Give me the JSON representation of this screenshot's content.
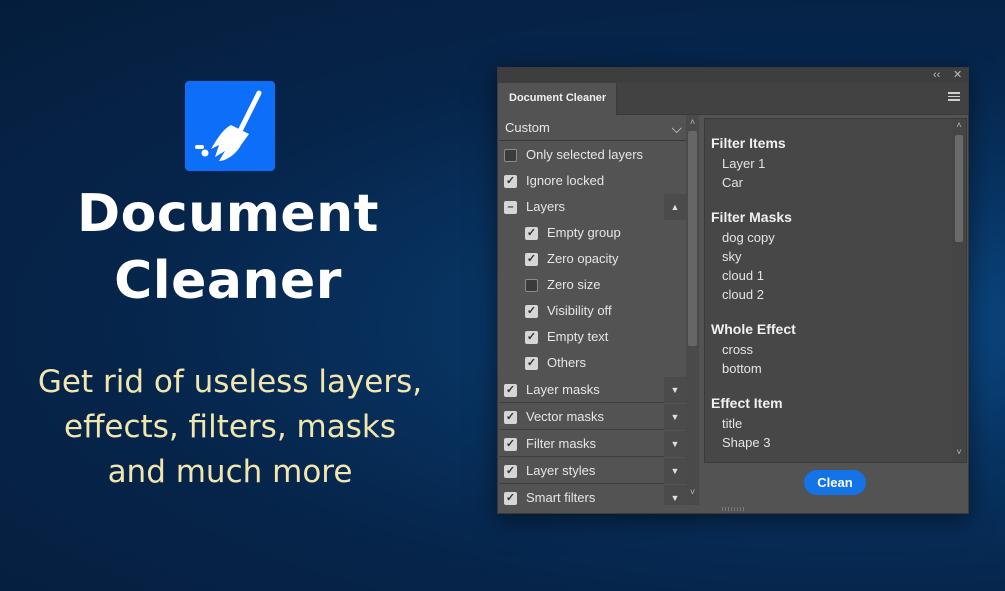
{
  "promo": {
    "title_line1": "Document",
    "title_line2": "Cleaner",
    "tagline_line1": "Get rid of useless layers,",
    "tagline_line2": "effects, filters, masks",
    "tagline_line3": "and much more",
    "logo_icon": "broom-icon",
    "brand_color": "#0d6ef9",
    "tagline_color": "#f1e6ad"
  },
  "panel": {
    "collapse_glyph": "‹‹",
    "close_glyph": "✕",
    "tab_label": "Document Cleaner",
    "preset": {
      "selected": "Custom"
    },
    "options": [
      {
        "label": "Only selected layers",
        "checked": false
      },
      {
        "label": "Ignore locked",
        "checked": true
      }
    ],
    "layers_group": {
      "label": "Layers",
      "state": "partial",
      "items": [
        {
          "label": "Empty group",
          "checked": true
        },
        {
          "label": "Zero opacity",
          "checked": true
        },
        {
          "label": "Zero size",
          "checked": false
        },
        {
          "label": "Visibility off",
          "checked": true
        },
        {
          "label": "Empty text",
          "checked": true
        },
        {
          "label": "Others",
          "checked": true
        }
      ]
    },
    "collapsed_groups": [
      {
        "label": "Layer masks",
        "checked": true
      },
      {
        "label": "Vector masks",
        "checked": true
      },
      {
        "label": "Filter masks",
        "checked": true
      },
      {
        "label": "Layer styles",
        "checked": true
      },
      {
        "label": "Smart filters",
        "checked": true
      }
    ],
    "results": [
      {
        "heading": "Filter Items",
        "items": [
          "Layer 1",
          "Car"
        ]
      },
      {
        "heading": "Filter Masks",
        "items": [
          "dog copy",
          "sky",
          "cloud 1",
          "cloud 2"
        ]
      },
      {
        "heading": "Whole Effect",
        "items": [
          "cross",
          "bottom"
        ]
      },
      {
        "heading": "Effect Item",
        "items": [
          "title",
          "Shape 3"
        ]
      }
    ],
    "clean_label": "Clean",
    "accent_color": "#1473e6"
  }
}
